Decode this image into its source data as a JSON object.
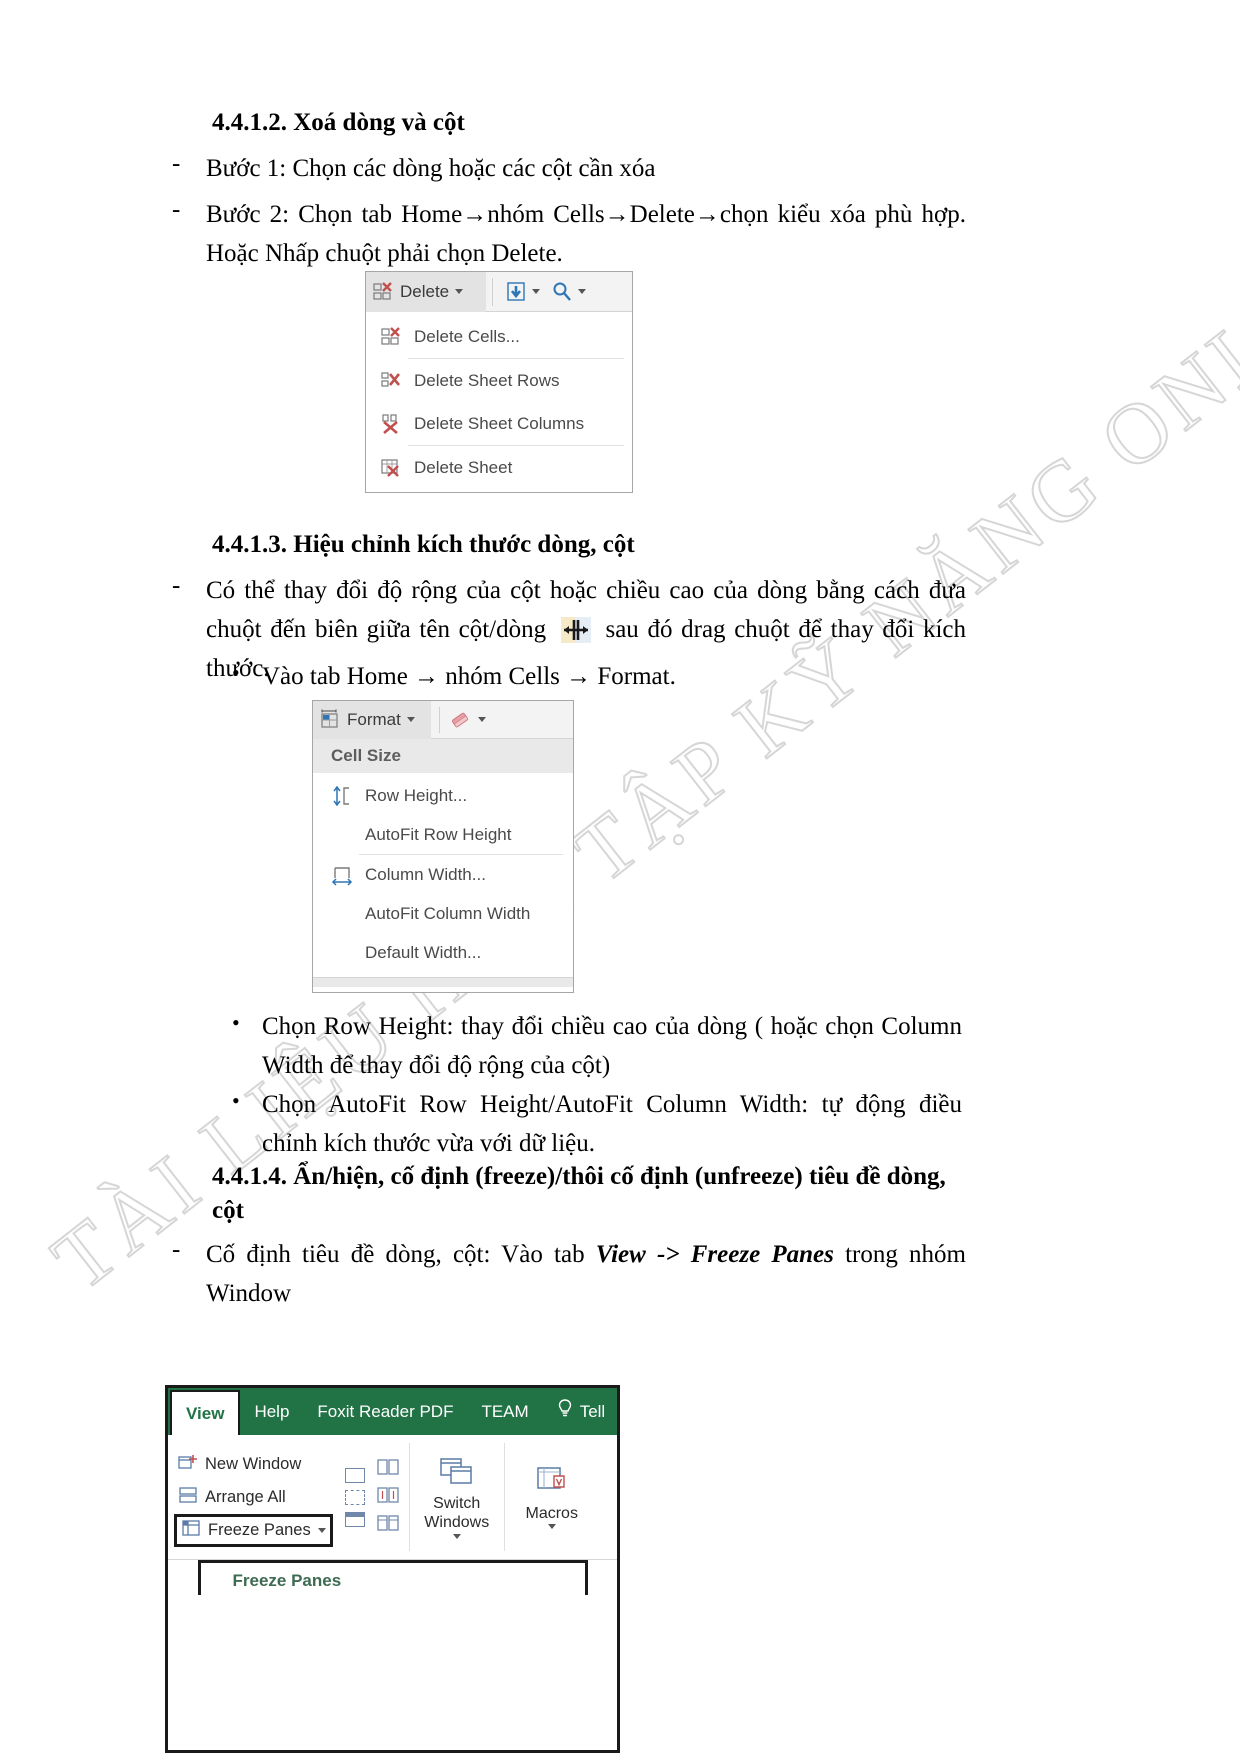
{
  "document": {
    "watermark": "TÀI LIỆU HỌC TẬP KỸ NĂNG ONLINE",
    "sections": [
      {
        "id": "s4412",
        "heading": "4.4.1.2. Xoá dòng và cột",
        "items": [
          {
            "marker": "-",
            "text": "Bước 1: Chọn các dòng hoặc các cột cần xóa"
          },
          {
            "marker": "-",
            "text": "Bước 2: Chọn tab Home→nhóm Cells→Delete→chọn kiểu xóa phù hợp. Hoặc Nhấp chuột phải chọn Delete."
          }
        ]
      },
      {
        "id": "s4413",
        "heading": "4.4.1.3. Hiệu chỉnh kích thước dòng, cột",
        "items": [
          {
            "marker": "-",
            "text_pre": "Có thể thay đổi độ rộng của cột hoặc chiều cao của dòng bằng cách đưa chuột đến biên giữa tên cột/dòng",
            "text_post": "sau đó drag chuột để thay đổi kích thước."
          },
          {
            "marker": "•",
            "text": "Vào tab Home → nhóm Cells → Format."
          },
          {
            "marker": "•",
            "text": "Chọn Row Height: thay đổi chiều cao của dòng ( hoặc chọn Column Width để thay đổi độ rộng của cột)"
          },
          {
            "marker": "•",
            "text": "Chọn AutoFit Row Height/AutoFit Column Width: tự động điều chỉnh kích thước vừa với dữ liệu."
          }
        ]
      },
      {
        "id": "s4414",
        "heading": "4.4.1.4. Ẩn/hiện, cố định (freeze)/thôi cố định (unfreeze) tiêu đề dòng, cột",
        "items": [
          {
            "marker": "-",
            "text_a": "Cố định tiêu đề dòng, cột: Vào tab ",
            "text_em": "View -> Freeze Panes",
            "text_b": " trong nhóm Window"
          }
        ]
      }
    ]
  },
  "figure_delete": {
    "name": "excel-delete-dropdown",
    "button_label": "Delete",
    "tool_icons": [
      "fill-down-icon",
      "find-select-icon"
    ],
    "menu_items": [
      {
        "label": "Delete Cells...",
        "accel": "D",
        "icon": "delete-cells-icon"
      },
      {
        "label": "Delete Sheet Rows",
        "accel": "R",
        "icon": "delete-rows-icon"
      },
      {
        "label": "Delete Sheet Columns",
        "accel": "C",
        "icon": "delete-columns-icon"
      },
      {
        "label": "Delete Sheet",
        "accel": "S",
        "icon": "delete-sheet-icon"
      }
    ]
  },
  "figure_format": {
    "name": "excel-format-dropdown",
    "button_label": "Format",
    "tool_icons": [
      "clear-eraser-icon"
    ],
    "group_header": "Cell Size",
    "menu_items": [
      {
        "label": "Row Height...",
        "accel": "H",
        "icon": "row-height-icon"
      },
      {
        "label": "AutoFit Row Height",
        "accel": "A",
        "icon": ""
      },
      {
        "label": "Column Width...",
        "accel": "W",
        "icon": "column-width-icon"
      },
      {
        "label": "AutoFit Column Width",
        "accel": "i",
        "icon": ""
      },
      {
        "label": "Default Width...",
        "accel": "D",
        "icon": ""
      }
    ]
  },
  "figure_view": {
    "name": "excel-view-ribbon",
    "tabs": [
      {
        "label": "View",
        "active": true
      },
      {
        "label": "Help",
        "active": false
      },
      {
        "label": "Foxit Reader PDF",
        "active": false
      },
      {
        "label": "TEAM",
        "active": false
      },
      {
        "label": "Tell",
        "active": false,
        "icon": "lightbulb-icon"
      }
    ],
    "window_group": [
      {
        "label": "New Window",
        "icon": "new-window-icon"
      },
      {
        "label": "Arrange All",
        "icon": "arrange-all-icon"
      },
      {
        "label": "Freeze Panes",
        "icon": "freeze-panes-icon",
        "highlighted": true,
        "has_caret": true
      }
    ],
    "split_group": [
      "split-icon",
      "hide-icon",
      "unhide-icon"
    ],
    "side_group": [
      "view-side-by-side-icon",
      "synchronous-scrolling-icon",
      "reset-window-position-icon"
    ],
    "big_buttons": [
      {
        "label_1": "Switch",
        "label_2": "Windows",
        "icon": "switch-windows-icon"
      },
      {
        "label_1": "Macros",
        "label_2": "",
        "icon": "macros-icon"
      }
    ],
    "dropdown_title": "Freeze Panes"
  }
}
